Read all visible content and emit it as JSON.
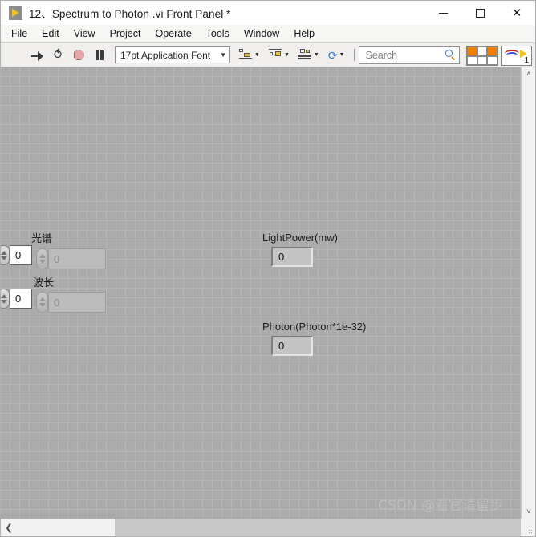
{
  "window": {
    "title": "12、Spectrum to Photon .vi Front Panel *",
    "vi_icon": "vi-run-arrow-icon",
    "buttons": {
      "minimize": "minimize-icon",
      "maximize": "maximize-icon",
      "close": "close-icon"
    }
  },
  "menubar": {
    "items": [
      {
        "label": "File"
      },
      {
        "label": "Edit"
      },
      {
        "label": "View"
      },
      {
        "label": "Project"
      },
      {
        "label": "Operate"
      },
      {
        "label": "Tools"
      },
      {
        "label": "Window"
      },
      {
        "label": "Help"
      }
    ]
  },
  "toolbar": {
    "run_icon": "run-arrow-icon",
    "run_continuous_icon": "run-continuously-icon",
    "abort_icon": "abort-execution-icon",
    "pause_icon": "pause-icon",
    "font_selector": {
      "value": "17pt Application Font",
      "caret": "▼"
    },
    "align_objects": {
      "name": "align-objects",
      "caret": "▼"
    },
    "distribute_objects": {
      "name": "distribute-objects",
      "caret": "▼"
    },
    "resize_objects": {
      "name": "resize-objects",
      "caret": "▼"
    },
    "reorder": {
      "name": "reorder-objects",
      "glyph": "⟳",
      "caret": "▼"
    },
    "search": {
      "placeholder": "Search",
      "value": "",
      "icon": "magnifier-icon"
    },
    "help_icon": "context-help-icon",
    "connector_pane": "connector-pane",
    "vi_icon_number": "1"
  },
  "panel": {
    "controls": [
      {
        "label": "光谱",
        "value": "0",
        "shadow_value": "0",
        "name": "spectrum"
      },
      {
        "label": "波长",
        "value": "0",
        "shadow_value": "0",
        "name": "wavelength"
      }
    ],
    "indicators": [
      {
        "label": "LightPower(mw)",
        "value": "0",
        "name": "light-power"
      },
      {
        "label": "Photon(Photon*1e-32)",
        "value": "0",
        "name": "photon"
      }
    ],
    "watermark": "CSDN @看官请留步"
  },
  "scrollbars": {
    "vertical_up": "˄",
    "vertical_down": "˅",
    "horizontal_left": "❮"
  },
  "colors": {
    "panel_background": "#ababab",
    "grid_line": "#b6b6b6",
    "accent_yellow": "#f5c518",
    "abort_red": "#e9a5a5",
    "connector_orange": "#f08000"
  }
}
